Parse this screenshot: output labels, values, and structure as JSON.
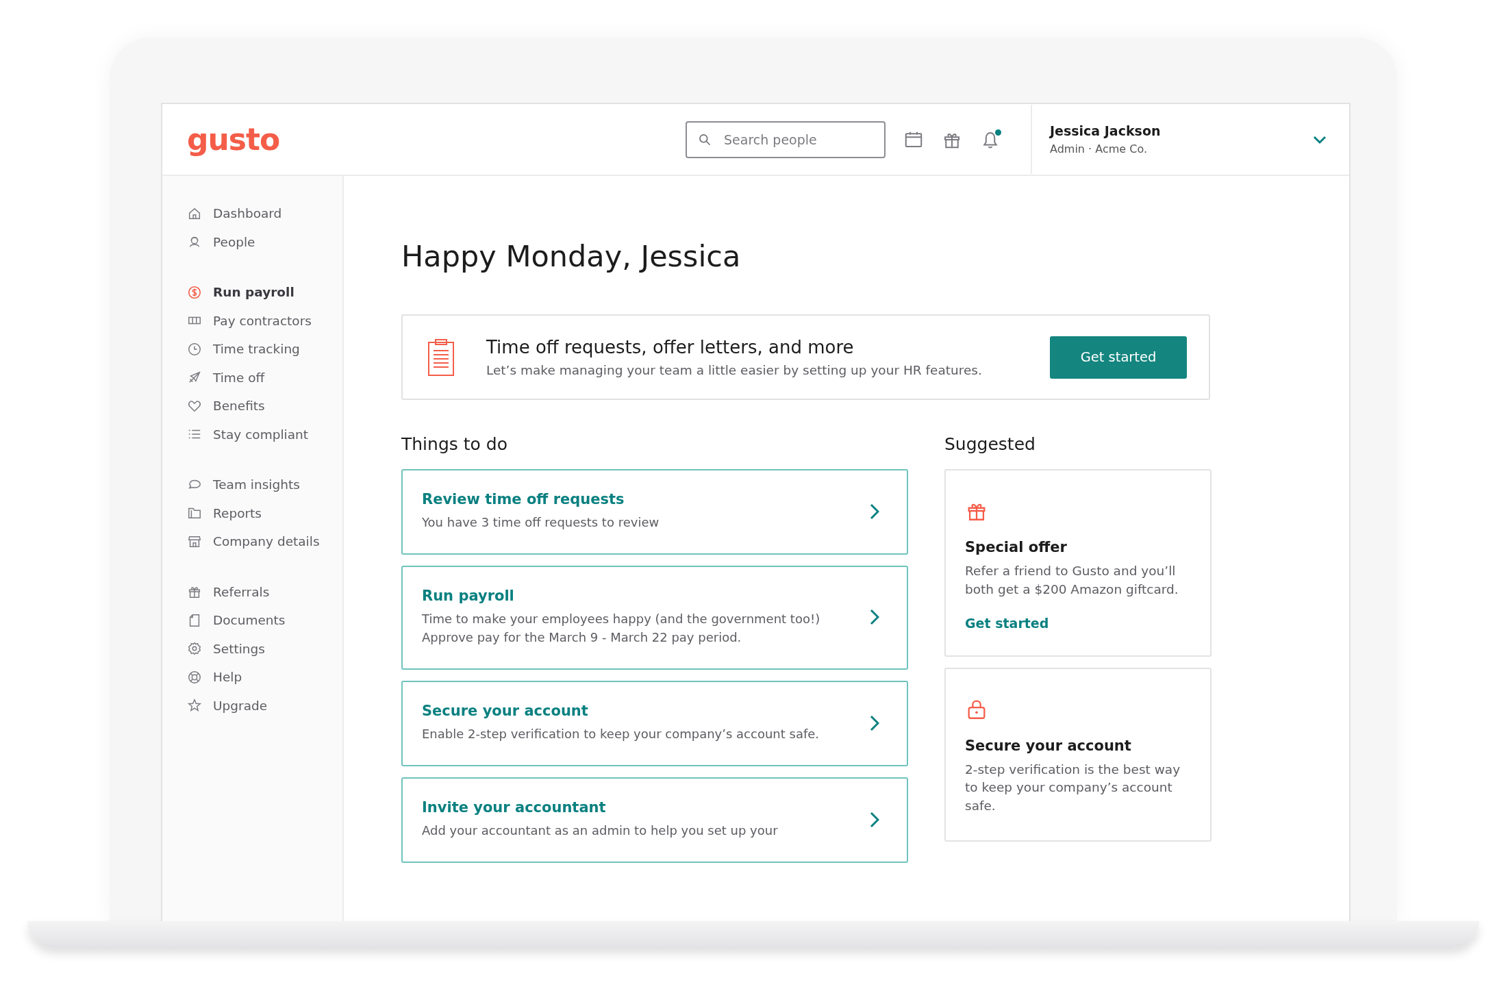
{
  "header": {
    "logo": "gusto",
    "search": {
      "placeholder": "Search people"
    },
    "notification": true,
    "user": {
      "name": "Jessica Jackson",
      "role": "Admin · Acme Co."
    }
  },
  "sidebar": {
    "groups": [
      {
        "items": [
          {
            "label": "Dashboard",
            "kind": "home",
            "selected": false
          },
          {
            "label": "People",
            "kind": "people",
            "selected": false
          }
        ]
      },
      {
        "items": [
          {
            "label": "Run payroll",
            "kind": "dollar",
            "selected": true
          },
          {
            "label": "Pay contractors",
            "kind": "cash",
            "selected": false
          },
          {
            "label": "Time tracking",
            "kind": "clock",
            "selected": false
          },
          {
            "label": "Time off",
            "kind": "plane",
            "selected": false
          },
          {
            "label": "Benefits",
            "kind": "heart",
            "selected": false
          },
          {
            "label": "Stay compliant",
            "kind": "list",
            "selected": false
          }
        ]
      },
      {
        "items": [
          {
            "label": "Team insights",
            "kind": "chat",
            "selected": false
          },
          {
            "label": "Reports",
            "kind": "folder",
            "selected": false
          },
          {
            "label": "Company details",
            "kind": "store",
            "selected": false
          }
        ]
      },
      {
        "items": [
          {
            "label": "Referrals",
            "kind": "gift",
            "selected": false
          },
          {
            "label": "Documents",
            "kind": "doc",
            "selected": false
          },
          {
            "label": "Settings",
            "kind": "gear",
            "selected": false
          },
          {
            "label": "Help",
            "kind": "help",
            "selected": false
          },
          {
            "label": "Upgrade",
            "kind": "star",
            "selected": false
          }
        ]
      }
    ]
  },
  "greeting": "Happy Monday, Jessica",
  "banner": {
    "title": "Time off requests, offer letters, and more",
    "text": "Let’s make managing your team a little easier by setting up your HR features.",
    "button": "Get started"
  },
  "todo": {
    "heading": "Things to do",
    "items": [
      {
        "title": "Review time off requests",
        "text": "You have 3 time off requests to review"
      },
      {
        "title": "Run payroll",
        "text": "Time to make your employees happy (and the government too!) Approve pay for the March 9 - March 22 pay period."
      },
      {
        "title": "Secure your account",
        "text": "Enable 2-step verification to keep your company’s account safe."
      },
      {
        "title": "Invite your accountant",
        "text": "Add your accountant as an admin to help you set up your"
      }
    ]
  },
  "suggested": {
    "heading": "Suggested",
    "cards": [
      {
        "kind": "gift",
        "title": "Special offer",
        "text": "Refer a friend to Gusto and you’ll both get a $200 Amazon giftcard.",
        "link": "Get started"
      },
      {
        "kind": "lock",
        "title": "Secure your account",
        "text": "2-step verification is the best way to keep your company’s account safe."
      }
    ]
  }
}
